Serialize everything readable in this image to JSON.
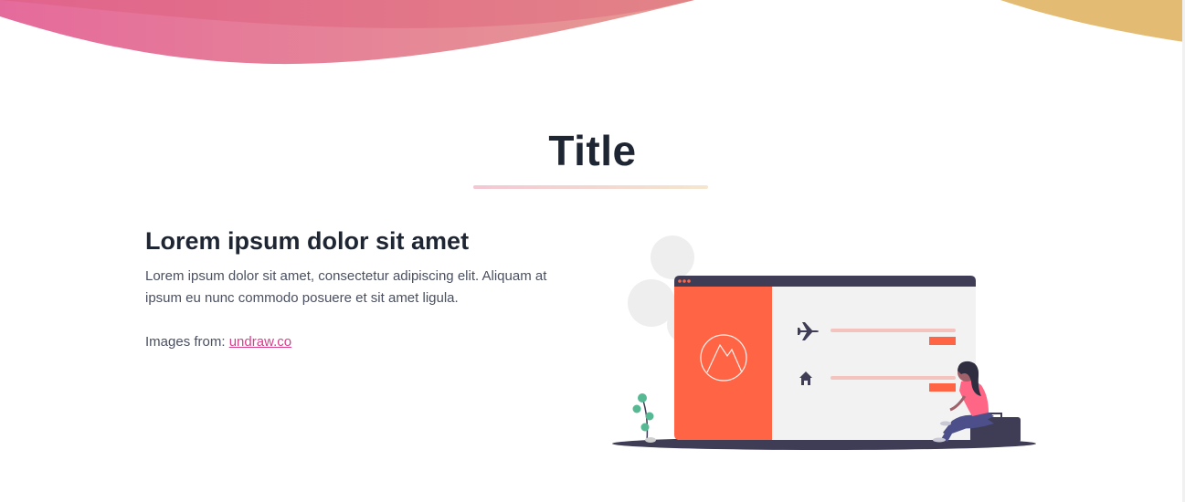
{
  "header": {
    "title": "Title"
  },
  "section": {
    "heading": "Lorem ipsum dolor sit amet",
    "body": "Lorem ipsum dolor sit amet, consectetur adipiscing elit. Aliquam at ipsum eu nunc commodo posuere et sit amet ligula.",
    "credit_prefix": "Images from: ",
    "credit_link": "undraw.co"
  },
  "colors": {
    "wave_start": "#d94a7b",
    "wave_end": "#e3bd72",
    "accent": "#ff6445",
    "dark": "#3f3d56",
    "link": "#d63f8c"
  },
  "illustration": {
    "icons": [
      "airplane-icon",
      "house-icon",
      "mountain-logo-icon"
    ]
  }
}
